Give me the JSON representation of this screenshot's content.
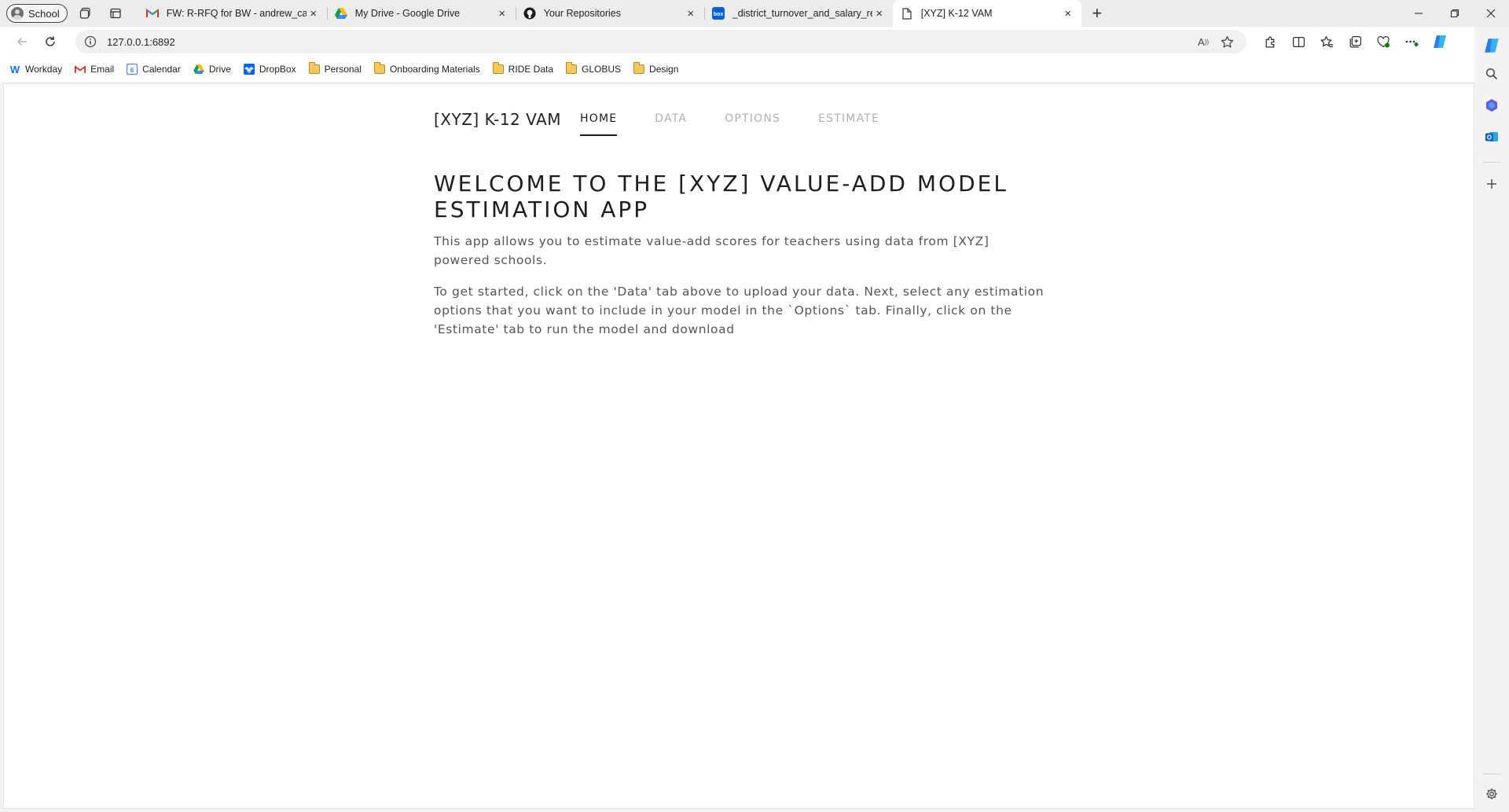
{
  "browser": {
    "profile_label": "School",
    "tabs": [
      {
        "title": "FW: R-RFQ for BW - andrew_cam",
        "icon": "gmail-icon",
        "active": false
      },
      {
        "title": "My Drive - Google Drive",
        "icon": "google-drive-icon",
        "active": false
      },
      {
        "title": "Your Repositories",
        "icon": "github-icon",
        "active": false
      },
      {
        "title": "_district_turnover_and_salary_rep",
        "icon": "box-icon",
        "active": false
      },
      {
        "title": "[XYZ] K-12 VAM",
        "icon": "page-icon",
        "active": true
      }
    ],
    "url": "127.0.0.1:6892",
    "bookmarks": [
      {
        "label": "Workday",
        "icon": "workday-icon"
      },
      {
        "label": "Email",
        "icon": "gmail-icon"
      },
      {
        "label": "Calendar",
        "icon": "calendar-icon"
      },
      {
        "label": "Drive",
        "icon": "google-drive-icon"
      },
      {
        "label": "DropBox",
        "icon": "dropbox-icon"
      },
      {
        "label": "Personal",
        "icon": "folder-icon"
      },
      {
        "label": "Onboarding Materials",
        "icon": "folder-icon"
      },
      {
        "label": "RIDE Data",
        "icon": "folder-icon"
      },
      {
        "label": "GLOBUS",
        "icon": "folder-icon"
      },
      {
        "label": "Design",
        "icon": "folder-icon"
      }
    ]
  },
  "app": {
    "brand": "[XYZ] K-12 VAM",
    "nav": [
      {
        "label": "HOME",
        "active": true
      },
      {
        "label": "DATA",
        "active": false
      },
      {
        "label": "OPTIONS",
        "active": false
      },
      {
        "label": "ESTIMATE",
        "active": false
      }
    ],
    "headline": "WELCOME TO THE [XYZ] VALUE-ADD MODEL ESTIMATION APP",
    "intro": "This app allows you to estimate value-add scores for teachers using data from [XYZ] powered schools.",
    "instructions": "To get started, click on the 'Data' tab above to upload your data. Next, select any estimation options that you want to include in your model in the `Options` tab. Finally, click on the 'Estimate' tab to run the model and download"
  },
  "colors": {
    "accent": "#1b1b1b",
    "muted_nav": "#b0b0b0",
    "body_text": "#555555"
  }
}
